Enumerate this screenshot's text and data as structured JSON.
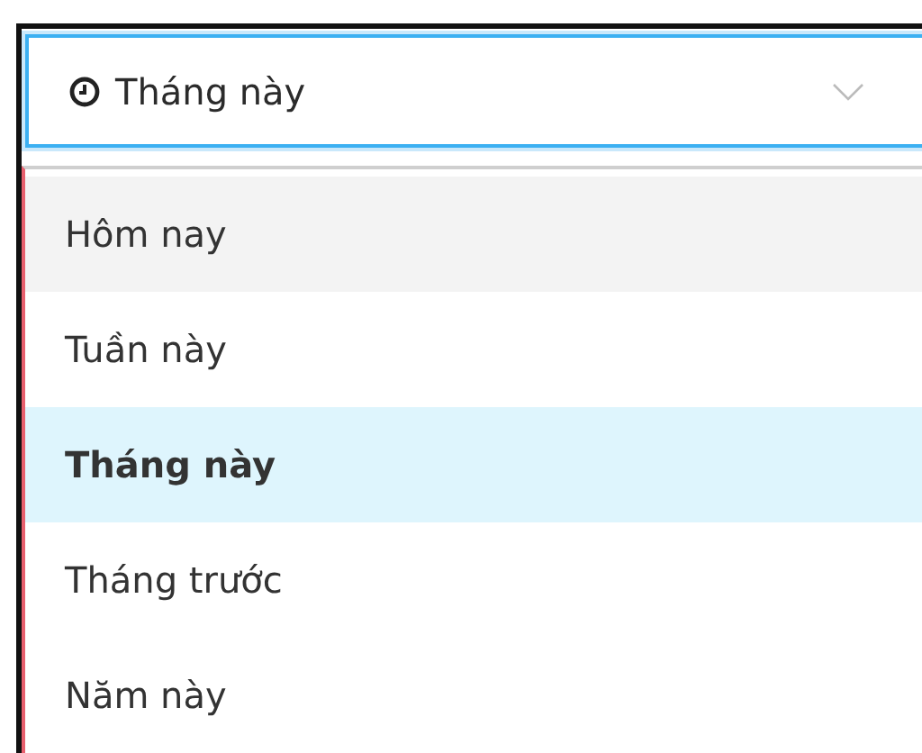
{
  "select": {
    "value": "Tháng này",
    "expanded": true
  },
  "options": [
    {
      "label": "Hôm nay",
      "selected": false,
      "hovered": true
    },
    {
      "label": "Tuần này",
      "selected": false,
      "hovered": false
    },
    {
      "label": "Tháng này",
      "selected": true,
      "hovered": false
    },
    {
      "label": "Tháng trước",
      "selected": false,
      "hovered": false
    },
    {
      "label": "Năm này",
      "selected": false,
      "hovered": false
    }
  ]
}
